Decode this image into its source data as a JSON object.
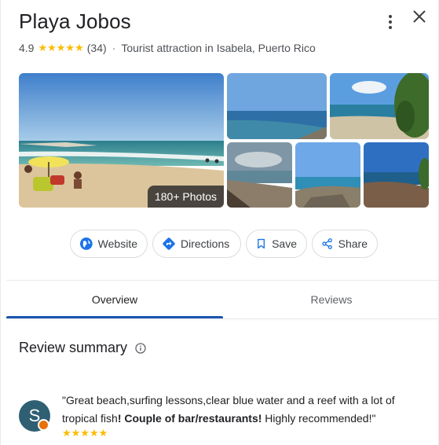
{
  "place": {
    "title": "Playa Jobos",
    "rating": "4.9",
    "stars": "★★★★★",
    "review_count": "(34)",
    "separator": "·",
    "category": "Tourist attraction in Isabela, Puerto Rico"
  },
  "header_icons": {
    "menu": "more-vert-icon",
    "close": "close-icon"
  },
  "photos": {
    "badge_label": "180+ Photos"
  },
  "actions": [
    {
      "label": "Website",
      "icon": "globe-icon"
    },
    {
      "label": "Directions",
      "icon": "directions-icon"
    },
    {
      "label": "Save",
      "icon": "bookmark-icon"
    },
    {
      "label": "Share",
      "icon": "share-icon"
    }
  ],
  "tabs": [
    {
      "label": "Overview",
      "active": true
    },
    {
      "label": "Reviews",
      "active": false
    }
  ],
  "review_summary": {
    "title": "Review summary",
    "info_icon": "info-icon"
  },
  "review": {
    "avatar_letter": "S",
    "text_part1": "\"Great beach,surfing lessons,clear blue water and a reef with a lot of tropical fish",
    "text_bold": "! Couple of bar/restaurants!",
    "text_part2": " Highly recommended!\"",
    "stars": "★★★★★"
  },
  "colors": {
    "star": "#fbbc04",
    "accent_blue": "#1a73e8",
    "tab_indicator": "#1a56b0",
    "avatar_bg": "#2f5f72",
    "avatar_badge": "#e8710a"
  }
}
